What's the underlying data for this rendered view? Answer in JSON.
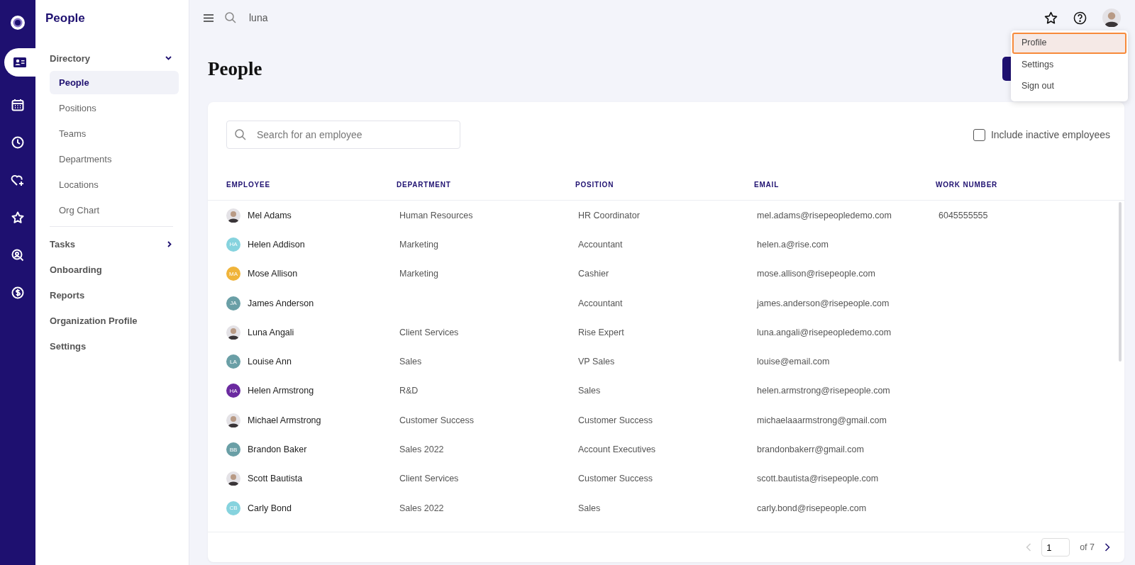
{
  "rail": [
    {
      "kind": "logo",
      "selected": false
    },
    {
      "kind": "id-card",
      "selected": true
    },
    {
      "kind": "calendar",
      "selected": false
    },
    {
      "kind": "clock",
      "selected": false
    },
    {
      "kind": "heart",
      "selected": false
    },
    {
      "kind": "star",
      "selected": false
    },
    {
      "kind": "search-person",
      "selected": false
    },
    {
      "kind": "dollar",
      "selected": false
    }
  ],
  "sidebar": {
    "title": "People",
    "items": [
      {
        "label": "Directory",
        "expanded": true,
        "children": [
          {
            "label": "People",
            "selected": true
          },
          {
            "label": "Positions",
            "selected": false
          },
          {
            "label": "Teams",
            "selected": false
          },
          {
            "label": "Departments",
            "selected": false
          },
          {
            "label": "Locations",
            "selected": false
          },
          {
            "label": "Org Chart",
            "selected": false
          }
        ]
      },
      {
        "label": "Tasks",
        "expanded": false
      },
      {
        "label": "Onboarding"
      },
      {
        "label": "Reports"
      },
      {
        "label": "Organization Profile"
      },
      {
        "label": "Settings"
      }
    ]
  },
  "topbar": {
    "search": {
      "value": "luna"
    }
  },
  "user_menu": {
    "items": [
      {
        "label": "Profile",
        "selected": true
      },
      {
        "label": "Settings",
        "selected": false
      },
      {
        "label": "Sign out",
        "selected": false
      }
    ]
  },
  "page_title": "People",
  "search": {
    "placeholder": "Search for an employee"
  },
  "include_inactive": {
    "label": "Include inactive employees",
    "checked": false
  },
  "table": {
    "columns": [
      "EMPLOYEE",
      "DEPARTMENT",
      "POSITION",
      "EMAIL",
      "WORK NUMBER"
    ],
    "rows": [
      {
        "avatar": {
          "kind": "photo"
        },
        "name": "Mel Adams",
        "department": "Human Resources",
        "position": "HR Coordinator",
        "email": "mel.adams@risepeopledemo.com",
        "work_number": "6045555555"
      },
      {
        "avatar": {
          "kind": "initials",
          "text": "HA",
          "color": "#86d3de"
        },
        "name": "Helen Addison",
        "department": "Marketing",
        "position": "Accountant",
        "email": "helen.a@rise.com"
      },
      {
        "avatar": {
          "kind": "initials",
          "text": "MA",
          "color": "#f0b43a"
        },
        "name": "Mose Allison",
        "department": "Marketing",
        "position": "Cashier",
        "email": "mose.allison@risepeople.com"
      },
      {
        "avatar": {
          "kind": "initials",
          "text": "JA",
          "color": "#6a9fa6"
        },
        "name": "James Anderson",
        "position": "Accountant",
        "email": "james.anderson@risepeople.com"
      },
      {
        "avatar": {
          "kind": "photo"
        },
        "name": "Luna Angali",
        "department": "Client Services",
        "position": "Rise Expert",
        "email": "luna.angali@risepeopledemo.com"
      },
      {
        "avatar": {
          "kind": "initials",
          "text": "LA",
          "color": "#6a9fa6"
        },
        "name": "Louise Ann",
        "department": "Sales",
        "position": "VP Sales",
        "email": "louise@email.com"
      },
      {
        "avatar": {
          "kind": "initials",
          "text": "HA",
          "color": "#6b2aa0"
        },
        "name": "Helen Armstrong",
        "department": "R&D",
        "position": "Sales",
        "email": "helen.armstrong@risepeople.com"
      },
      {
        "avatar": {
          "kind": "photo"
        },
        "name": "Michael Armstrong",
        "department": "Customer Success",
        "position": "Customer Success",
        "email": "michaelaaarmstrong@gmail.com"
      },
      {
        "avatar": {
          "kind": "initials",
          "text": "BB",
          "color": "#6a9fa6"
        },
        "name": "Brandon Baker",
        "department": "Sales 2022",
        "position": "Account Executives",
        "email": "brandonbakerr@gmail.com"
      },
      {
        "avatar": {
          "kind": "photo"
        },
        "name": "Scott Bautista",
        "department": "Client Services",
        "position": "Customer Success",
        "email": "scott.bautista@risepeople.com"
      },
      {
        "avatar": {
          "kind": "initials",
          "text": "CB",
          "color": "#86d3de"
        },
        "name": "Carly Bond",
        "department": "Sales 2022",
        "position": "Sales",
        "email": "carly.bond@risepeople.com"
      }
    ]
  },
  "pagination": {
    "page": "1",
    "total": "of 7",
    "prev_disabled": true
  }
}
